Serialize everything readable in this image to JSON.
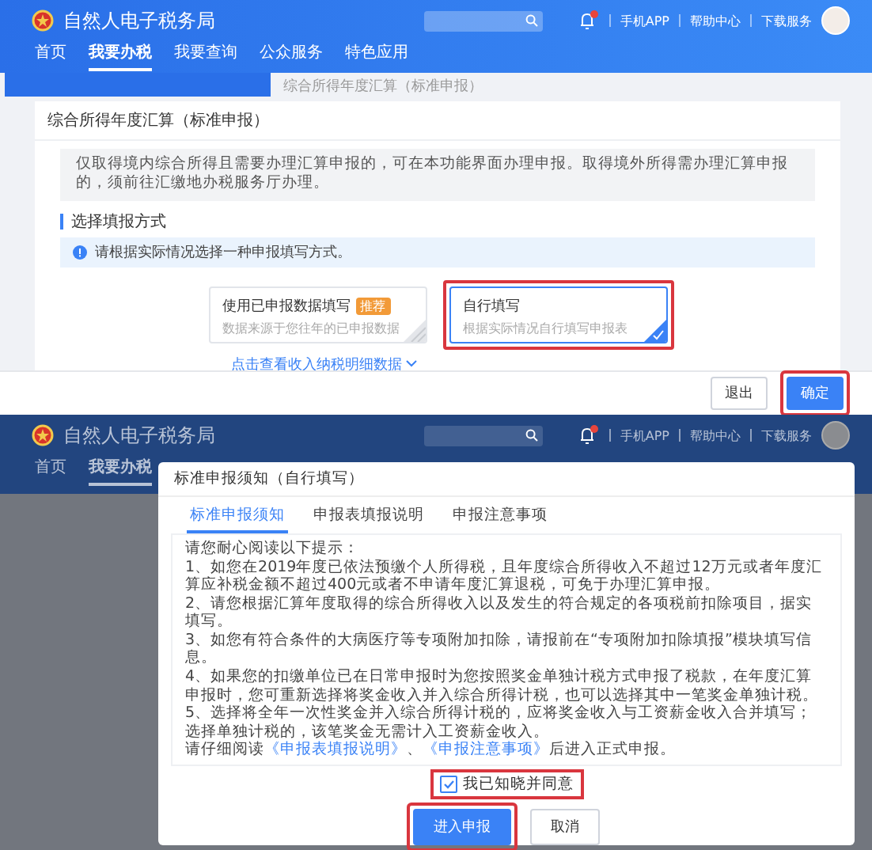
{
  "page": {
    "header": {
      "site_title": "自然人电子税务局",
      "links": [
        "手机APP",
        "帮助中心",
        "下载服务"
      ],
      "nav": [
        {
          "label": "首页",
          "selected": false
        },
        {
          "label": "我要办税",
          "selected": true
        },
        {
          "label": "我要查询",
          "selected": false
        },
        {
          "label": "公众服务",
          "selected": false
        },
        {
          "label": "特色应用",
          "selected": false
        }
      ]
    },
    "breadcrumb": "综合所得年度汇算（标准申报）",
    "card_title": "综合所得年度汇算（标准申报）",
    "notice": "仅取得境内综合所得且需要办理汇算申报的，可在本功能界面办理申报。取得境外所得需办理汇算申报的，须前往汇缴地办税服务厅办理。",
    "section_title": "选择填报方式",
    "info": "请根据实际情况选择一种申报填写方式。",
    "options": [
      {
        "title": "使用已申报数据填写",
        "badge": "推荐",
        "description": "数据来源于您往年的已申报数据",
        "selected": false,
        "highlighted": false
      },
      {
        "title": "自行填写",
        "description": "根据实际情况自行填写申报表",
        "selected": true,
        "highlighted": true
      }
    ],
    "detail_link": "点击查看收入纳税明细数据",
    "buttons": [
      {
        "label": "退出",
        "kind": "default",
        "highlighted": false
      },
      {
        "label": "确定",
        "kind": "primary",
        "highlighted": true
      }
    ]
  },
  "dialog_page": {
    "header": {
      "site_title": "自然人电子税务局",
      "links": [
        "手机APP",
        "帮助中心",
        "下载服务"
      ],
      "nav": [
        {
          "label": "首页",
          "selected": false
        },
        {
          "label": "我要办税",
          "selected": true
        }
      ]
    },
    "dialog": {
      "title": "标准申报须知（自行填写）",
      "tabs": [
        {
          "label": "标准申报须知",
          "selected": true
        },
        {
          "label": "申报表填报说明",
          "selected": false
        },
        {
          "label": "申报注意事项",
          "selected": false
        }
      ],
      "intro": "请您耐心阅读以下提示：",
      "items": [
        "1、如您在2019年度已依法预缴个人所得税，且年度综合所得收入不超过12万元或者年度汇算应补税金额不超过400元或者不申请年度汇算退税，可免于办理汇算申报。",
        "2、请您根据汇算年度取得的综合所得收入以及发生的符合规定的各项税前扣除项目，据实填写。",
        "3、如您有符合条件的大病医疗等专项附加扣除，请报前在“专项附加扣除填报”模块填写信息。",
        "4、如果您的扣缴单位已在日常申报时为您按照奖金单独计税方式申报了税款，在年度汇算申报时，您可重新选择将奖金收入并入综合所得计税，也可以选择其中一笔奖金单独计税。",
        "5、选择将全年一次性奖金并入综合所得计税的，应将奖金收入与工资薪金收入合并填写；选择单独计税的，该笔奖金无需计入工资薪金收入。"
      ],
      "closing_lead": "请仔细阅读",
      "closing_links": [
        "《申报表填报说明》",
        "《申报注意事项》"
      ],
      "closing_separator": "、",
      "closing_tail": "后进入正式申报。",
      "checkbox": {
        "label": "我已知晓并同意",
        "checked": true,
        "highlighted": true
      },
      "buttons": [
        {
          "label": "进入申报",
          "kind": "primary",
          "highlighted": true
        },
        {
          "label": "取消",
          "kind": "default",
          "highlighted": false
        }
      ]
    }
  }
}
